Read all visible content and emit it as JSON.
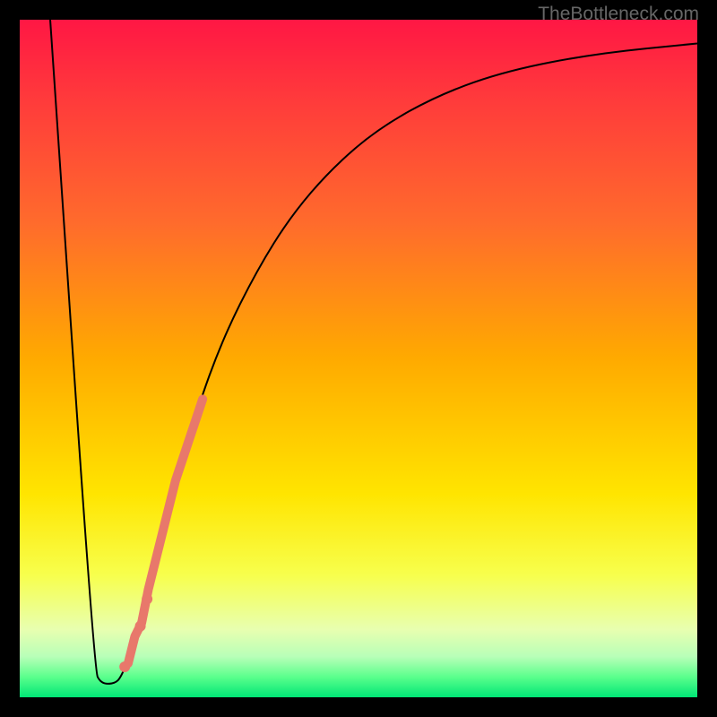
{
  "watermark": "TheBottleneck.com",
  "chart_data": {
    "type": "line",
    "title": "",
    "xlabel": "",
    "ylabel": "",
    "xlim": [
      0,
      100
    ],
    "ylim": [
      0,
      100
    ],
    "background_gradient": {
      "stops": [
        {
          "offset": 0,
          "color": "#ff1744"
        },
        {
          "offset": 12,
          "color": "#ff3b3b"
        },
        {
          "offset": 30,
          "color": "#ff6b2c"
        },
        {
          "offset": 50,
          "color": "#ffaa00"
        },
        {
          "offset": 70,
          "color": "#ffe500"
        },
        {
          "offset": 82,
          "color": "#f7ff4d"
        },
        {
          "offset": 90,
          "color": "#e8ffb0"
        },
        {
          "offset": 94,
          "color": "#b8ffb8"
        },
        {
          "offset": 97,
          "color": "#5bff8c"
        },
        {
          "offset": 100,
          "color": "#00e676"
        }
      ]
    },
    "series": [
      {
        "name": "bottleneck-curve",
        "type": "line",
        "color": "#000000",
        "points": [
          {
            "x": 4.5,
            "y": 100
          },
          {
            "x": 11,
            "y": 4
          },
          {
            "x": 12,
            "y": 2
          },
          {
            "x": 14,
            "y": 2
          },
          {
            "x": 15,
            "y": 3
          },
          {
            "x": 17,
            "y": 8
          },
          {
            "x": 19,
            "y": 16
          },
          {
            "x": 22,
            "y": 28
          },
          {
            "x": 26,
            "y": 42
          },
          {
            "x": 30,
            "y": 53
          },
          {
            "x": 35,
            "y": 63
          },
          {
            "x": 40,
            "y": 71
          },
          {
            "x": 46,
            "y": 78
          },
          {
            "x": 53,
            "y": 84
          },
          {
            "x": 62,
            "y": 89
          },
          {
            "x": 72,
            "y": 92.5
          },
          {
            "x": 85,
            "y": 95
          },
          {
            "x": 100,
            "y": 96.5
          }
        ]
      },
      {
        "name": "highlight-band",
        "type": "scatter",
        "color": "#e8786b",
        "stroke_width": 10,
        "points": [
          {
            "x": 16,
            "y": 5
          },
          {
            "x": 17,
            "y": 9
          },
          {
            "x": 18,
            "y": 11
          },
          {
            "x": 19,
            "y": 16
          },
          {
            "x": 20,
            "y": 20
          },
          {
            "x": 21,
            "y": 24
          },
          {
            "x": 22,
            "y": 28
          },
          {
            "x": 23,
            "y": 32
          },
          {
            "x": 24,
            "y": 35
          },
          {
            "x": 25,
            "y": 38
          },
          {
            "x": 26,
            "y": 41
          },
          {
            "x": 27,
            "y": 44
          }
        ]
      },
      {
        "name": "highlight-dots",
        "type": "scatter",
        "color": "#e8786b",
        "radius": 6,
        "points": [
          {
            "x": 15.5,
            "y": 4.5
          },
          {
            "x": 17.8,
            "y": 10.5
          },
          {
            "x": 18.8,
            "y": 14.5
          }
        ]
      }
    ]
  }
}
